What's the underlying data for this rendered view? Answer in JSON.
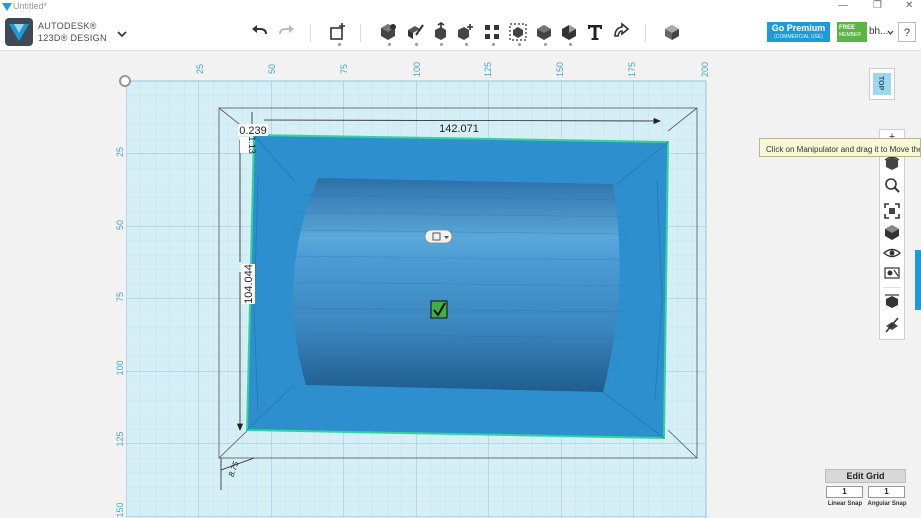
{
  "titlebar": {
    "title": "Untitled*",
    "controls": [
      "—",
      "❐",
      "✕"
    ]
  },
  "brand": {
    "company": "AUTODESK®",
    "product": "123D® DESIGN"
  },
  "premium": {
    "label": "Go Premium",
    "sub": "(COMMERCIAL USE)"
  },
  "member": {
    "line1": "FREE",
    "line2": "MEMBER",
    "user": "bh...",
    "help": "?"
  },
  "view": {
    "cube_label": "TOP"
  },
  "tooltip": {
    "text": "Click on Manipulator and drag it to Move the selec"
  },
  "ruler": {
    "top_ticks": [
      "25",
      "50",
      "75",
      "100",
      "125",
      "150",
      "175",
      "200"
    ],
    "left_ticks": [
      "25",
      "50",
      "75",
      "100",
      "125",
      "150"
    ]
  },
  "dimensions": {
    "top_offset": "0.239",
    "width": "142.071",
    "left_small": "1.13",
    "height": "104.044",
    "corner": "8.75"
  },
  "grid_panel": {
    "title": "Edit Grid",
    "linear_value": "1",
    "angular_value": "1",
    "linear_label": "Linear Snap",
    "angular_label": "Angular Snap"
  },
  "colors": {
    "brand_accent": "#1e9bd7",
    "premium": "#1e9bd7",
    "member_badge": "#5bb544",
    "grid_bg": "#d6eef5",
    "grid_line": "#a8d3e2",
    "object_fill": "#2e8fcf",
    "selection": "#31d59c",
    "tooltip_bg": "#f7f8d6"
  }
}
